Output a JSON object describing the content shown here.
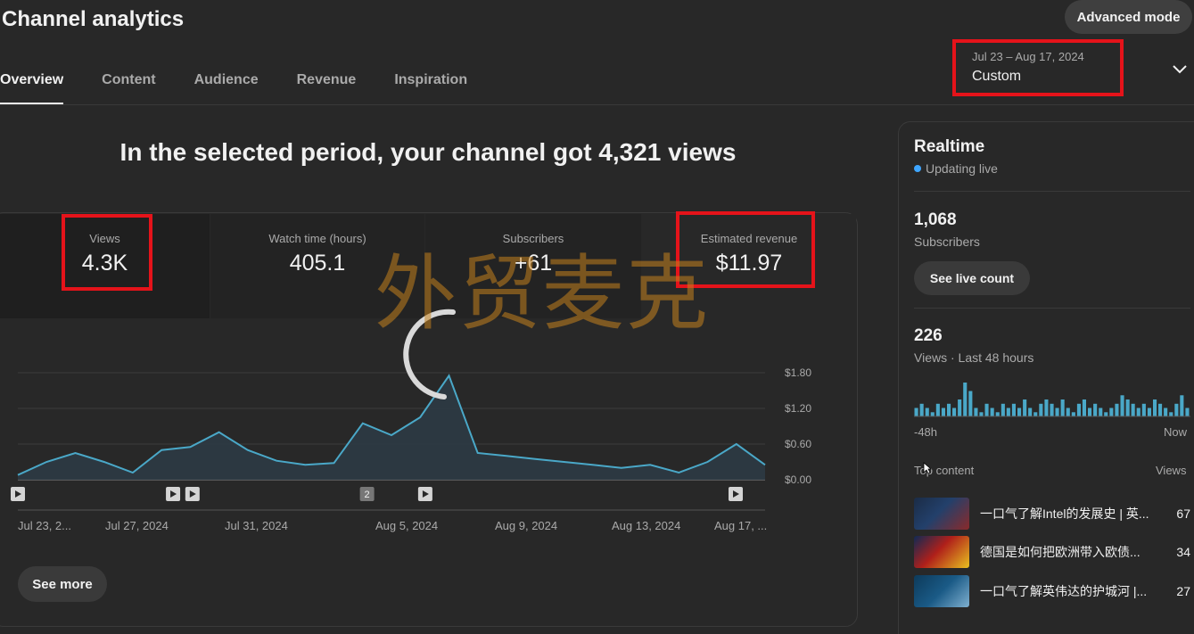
{
  "header": {
    "title": "Channel analytics",
    "advanced_mode": "Advanced mode",
    "tabs": [
      "Overview",
      "Content",
      "Audience",
      "Revenue",
      "Inspiration"
    ],
    "date_range": "Jul 23 – Aug 17, 2024",
    "range_label": "Custom"
  },
  "overview": {
    "headline": "In the selected period, your channel got 4,321 views",
    "metrics": [
      {
        "label": "Views",
        "value": "4.3K"
      },
      {
        "label": "Watch time (hours)",
        "value": "405.1"
      },
      {
        "label": "Subscribers",
        "value": "+61"
      },
      {
        "label": "Estimated revenue",
        "value": "$11.97"
      }
    ],
    "see_more": "See more",
    "watermark": "外贸麦克"
  },
  "chart_data": {
    "type": "area",
    "series": [
      {
        "values": [
          0.08,
          0.3,
          0.45,
          0.3,
          0.12,
          0.5,
          0.55,
          0.8,
          0.5,
          0.32,
          0.25,
          0.28,
          0.95,
          0.75,
          1.05,
          1.75,
          0.45,
          0.4,
          0.35,
          0.3,
          0.25,
          0.2,
          0.25,
          0.12,
          0.3,
          0.6,
          0.25
        ]
      }
    ],
    "y_ticks": [
      "$1.80",
      "$1.20",
      "$0.60",
      "$0.00"
    ],
    "ylim": [
      0,
      1.8
    ],
    "x_labels": [
      "Jul 23, 2...",
      "Jul 27, 2024",
      "Jul 31, 2024",
      "Aug 5, 2024",
      "Aug 9, 2024",
      "Aug 13, 2024",
      "Aug 17, ..."
    ],
    "markers": [
      {
        "index": 0,
        "kind": "video"
      },
      {
        "index": 8,
        "kind": "video"
      },
      {
        "index": 9,
        "kind": "video"
      },
      {
        "index": 18,
        "kind": "count",
        "label": "2"
      },
      {
        "index": 21,
        "kind": "video"
      },
      {
        "index": 37,
        "kind": "video"
      }
    ],
    "grid": true
  },
  "realtime": {
    "title": "Realtime",
    "status": "Updating live",
    "subscribers_value": "1,068",
    "subscribers_label": "Subscribers",
    "live_button": "See live count",
    "views_value": "226",
    "views_label": "Views · Last 48 hours",
    "axis_start": "-48h",
    "axis_end": "Now",
    "bars": [
      2,
      3,
      2,
      1,
      3,
      2,
      3,
      2,
      4,
      8,
      6,
      2,
      1,
      3,
      2,
      1,
      3,
      2,
      3,
      2,
      4,
      2,
      1,
      3,
      4,
      3,
      2,
      4,
      2,
      1,
      3,
      4,
      2,
      3,
      2,
      1,
      2,
      3,
      5,
      4,
      3,
      2,
      3,
      2,
      4,
      3,
      2,
      1,
      3,
      5,
      2
    ],
    "top_content_label": "Top content",
    "views_col": "Views",
    "top_content": [
      {
        "title": "一口气了解Intel的发展史 | 英...",
        "views": "67"
      },
      {
        "title": "德国是如何把欧洲带入欧债...",
        "views": "34"
      },
      {
        "title": "一口气了解英伟达的护城河 |...",
        "views": "27"
      }
    ]
  }
}
